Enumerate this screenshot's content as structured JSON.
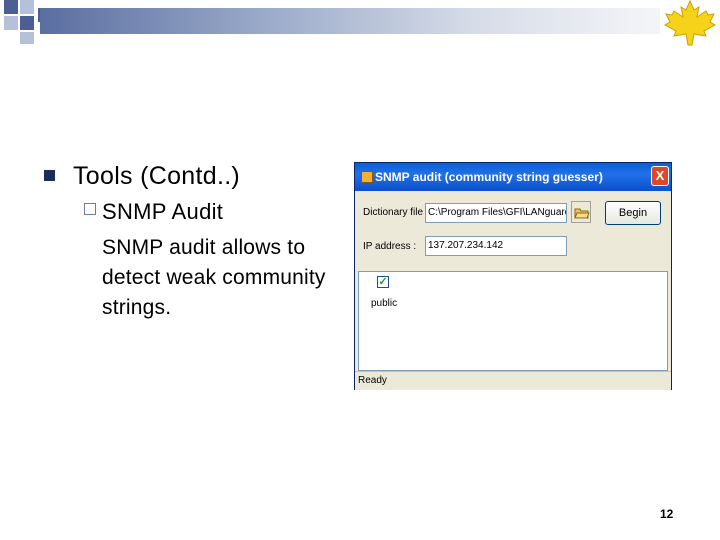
{
  "slide": {
    "title": "Tools (Contd..)",
    "subtitle": "SNMP Audit",
    "paragraph": "SNMP audit allows to detect weak community strings.",
    "page_number": "12",
    "main_bullet": "n",
    "sub_bullet": "¨"
  },
  "dialog": {
    "title": "SNMP audit (community string guesser)",
    "close_label": "X",
    "dictionary_label": "Dictionary file :",
    "dictionary_value": "C:\\Program Files\\GFI\\LANguard Net",
    "ip_label": "IP address :",
    "ip_value": "137.207.234.142",
    "begin_label": "Begin",
    "result_item": "public",
    "status": "Ready"
  },
  "colors": {
    "band_dark": "#4c5f92",
    "titlebar": "#0a5fd8",
    "maple_leaf": "#f6d21a"
  },
  "icons": [
    "maple-leaf-logo",
    "folder-open-icon",
    "close-icon",
    "checkbox-icon",
    "app-icon"
  ]
}
